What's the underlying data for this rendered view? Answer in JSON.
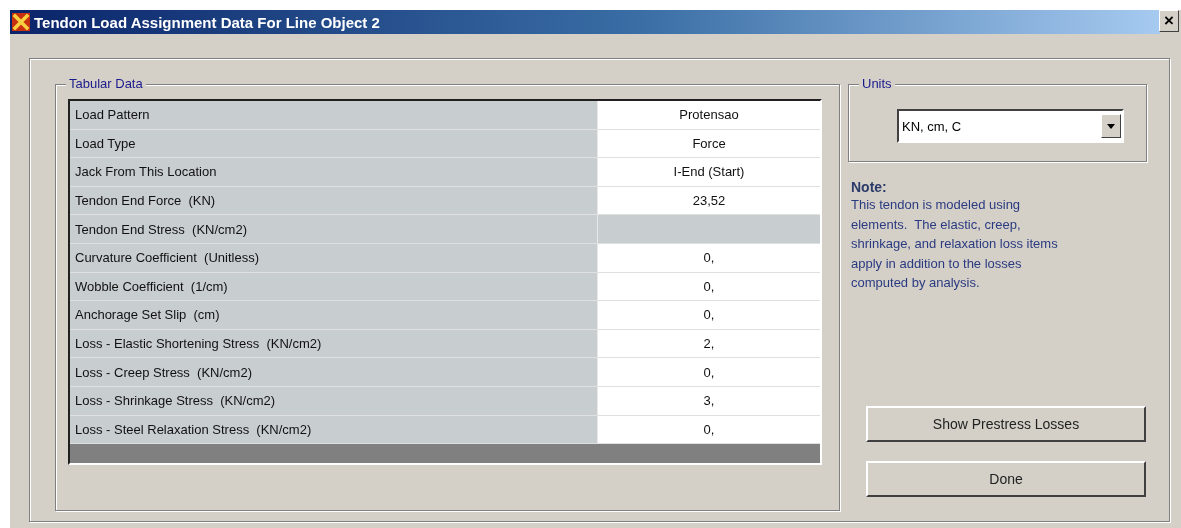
{
  "window": {
    "title": "Tendon Load Assignment Data For Line Object 2",
    "close": "×"
  },
  "tabular_data": {
    "title": "Tabular Data",
    "rows": [
      {
        "label": "Load Pattern",
        "value": "Protensao",
        "disabled": false
      },
      {
        "label": "Load Type",
        "value": "Force",
        "disabled": false
      },
      {
        "label": "Jack From This Location",
        "value": "I-End (Start)",
        "disabled": false
      },
      {
        "label": "Tendon End Force  (KN)",
        "value": "23,52",
        "disabled": false
      },
      {
        "label": "Tendon End Stress  (KN/cm2)",
        "value": "",
        "disabled": true
      },
      {
        "label": "Curvature Coefficient  (Unitless)",
        "value": "0,",
        "disabled": false
      },
      {
        "label": "Wobble Coefficient  (1/cm)",
        "value": "0,",
        "disabled": false
      },
      {
        "label": "Anchorage Set Slip  (cm)",
        "value": "0,",
        "disabled": false
      },
      {
        "label": "Loss - Elastic Shortening Stress  (KN/cm2)",
        "value": "2,",
        "disabled": false
      },
      {
        "label": "Loss - Creep Stress  (KN/cm2)",
        "value": "0,",
        "disabled": false
      },
      {
        "label": "Loss - Shrinkage Stress  (KN/cm2)",
        "value": "3,",
        "disabled": false
      },
      {
        "label": "Loss - Steel Relaxation Stress  (KN/cm2)",
        "value": "0,",
        "disabled": false
      }
    ]
  },
  "units": {
    "title": "Units",
    "value": "KN, cm, C"
  },
  "note": {
    "title": "Note:",
    "text": "This tendon is modeled using elements.  The elastic, creep, shrinkage, and relaxation loss items apply in addition to the losses computed by analysis."
  },
  "buttons": [
    "Show Prestress Losses",
    "Done"
  ]
}
